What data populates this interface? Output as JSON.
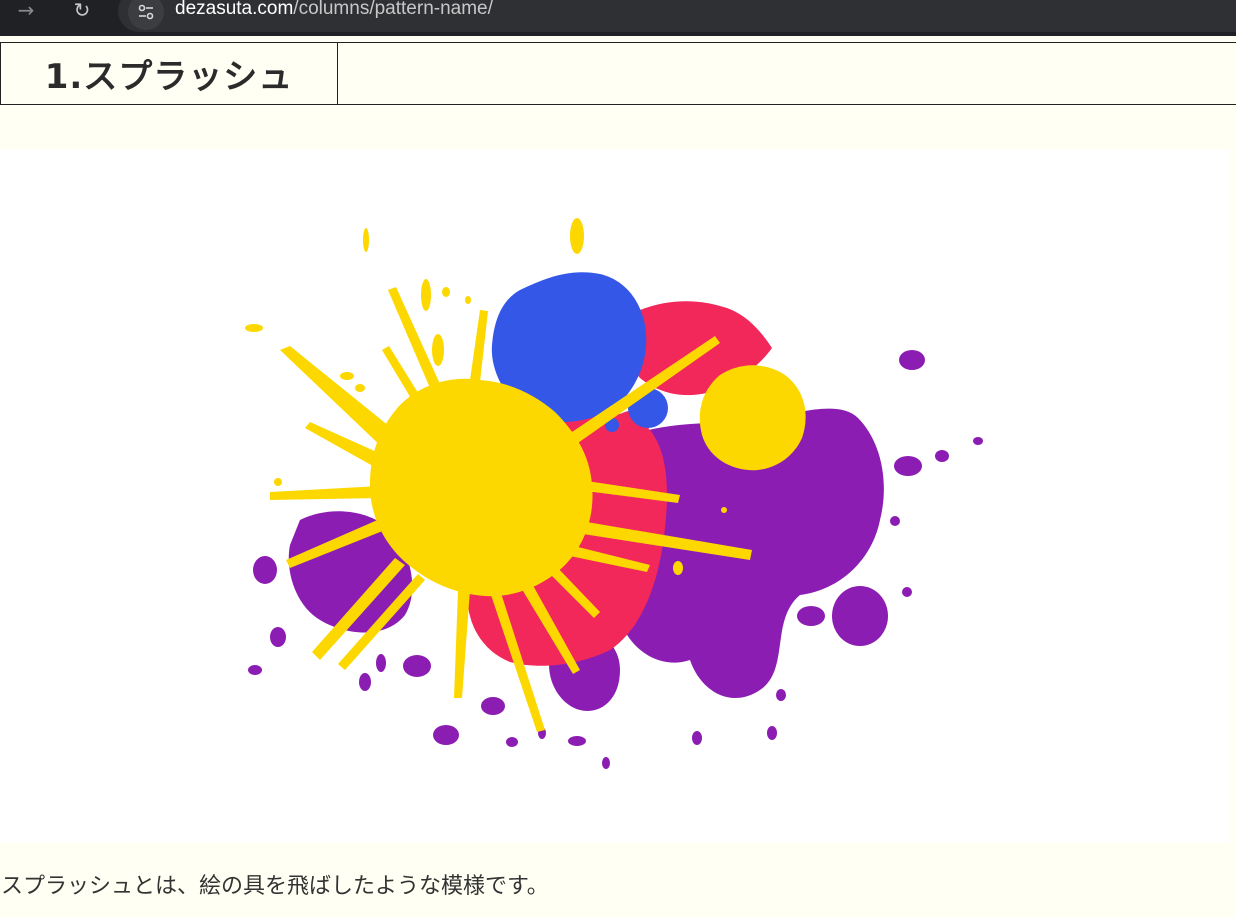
{
  "browser": {
    "forward_icon": "arrow-forward-icon",
    "reload_icon": "reload-icon",
    "site_info_icon": "tune-icon",
    "url_domain": "dezasuta.com",
    "url_path": "/columns/pattern-name/"
  },
  "article": {
    "section_heading": "1.スプラッシュ",
    "figure_alt": "splash-paint-illustration",
    "caption": "スプラッシュとは、絵の具を飛ばしたような模様です。"
  },
  "colors": {
    "page_background": "#fffff3",
    "splash_yellow": "#fcd800",
    "splash_blue": "#3457e8",
    "splash_red": "#f2275a",
    "splash_purple": "#8c1db3"
  }
}
